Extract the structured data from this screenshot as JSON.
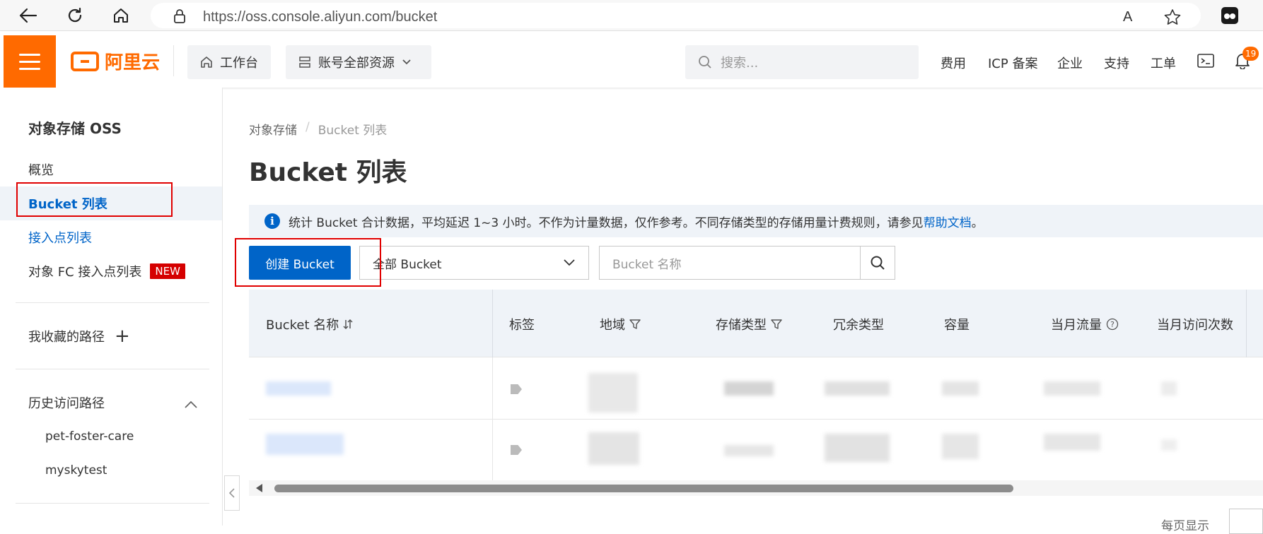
{
  "browser": {
    "url": "https://oss.console.aliyun.com/bucket",
    "reader_icon": "A"
  },
  "topnav": {
    "logo_text": "阿里云",
    "workbench": "工作台",
    "resources": "账号全部资源",
    "search_placeholder": "搜索...",
    "links": [
      "费用",
      "ICP 备案",
      "企业",
      "支持",
      "工单"
    ],
    "notification_count": "19",
    "accent_color": "#ff6a00"
  },
  "sidebar": {
    "title": "对象存储 OSS",
    "items": [
      {
        "label": "概览"
      },
      {
        "label": "Bucket 列表"
      },
      {
        "label": "接入点列表"
      },
      {
        "label": "对象 FC 接入点列表",
        "badge": "NEW"
      }
    ],
    "favorites_label": "我收藏的路径",
    "favorites_add": "+",
    "history_label": "历史访问路径",
    "history_items": [
      "pet-foster-care",
      "myskytest"
    ]
  },
  "main": {
    "breadcrumb": [
      "对象存储",
      "/",
      "Bucket 列表"
    ],
    "title": "Bucket 列表",
    "notice_text": "统计 Bucket 合计数据，平均延迟 1~3 小时。不作为计量数据，仅作参考。不同存储类型的存储用量计费规则，请参见",
    "notice_link": "帮助文档",
    "notice_end": "。",
    "create_button": "创建 Bucket",
    "filter_select": "全部 Bucket",
    "name_placeholder": "Bucket 名称",
    "columns": [
      "Bucket 名称",
      "标签",
      "地域",
      "存储类型",
      "冗余类型",
      "容量",
      "当月流量",
      "当月访问次数"
    ],
    "footer_label": "每页显示"
  }
}
